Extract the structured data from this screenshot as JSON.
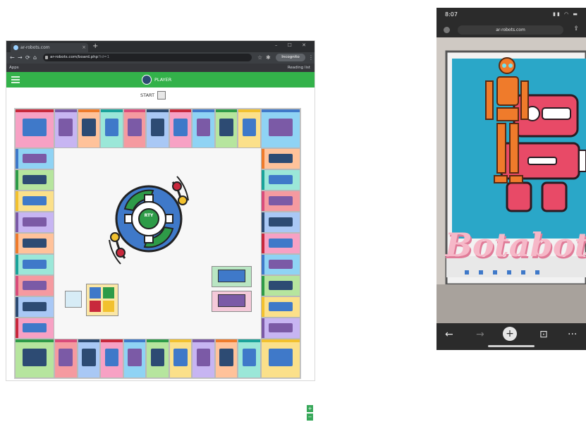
{
  "browser": {
    "tab_title": "ar-robots.com",
    "new_tab_symbol": "+",
    "window_controls": "– ☐ ✕",
    "tab_close_symbol": "×",
    "nav": {
      "back": "←",
      "forward": "→",
      "reload": "⟳",
      "home": "⌂"
    },
    "address": "ar-robots.com/board.php",
    "address_suffix": "?id=1",
    "profile_label": "Incognito",
    "bookmarks": {
      "apps_label": "Apps",
      "reading_list_label": "Reading list"
    }
  },
  "game": {
    "menu_icon": "hamburger-icon",
    "player_name": "PLAYER",
    "start_label": "START",
    "center_label": "RTY",
    "zoom_in": "+",
    "zoom_out": "−",
    "colors": {
      "header": "#33b24a",
      "accent_blue": "#3f79c9",
      "accent_green": "#2e9b48",
      "accent_yellow": "#f2c12e",
      "accent_red": "#c8283c"
    }
  },
  "phone": {
    "time": "8:07",
    "system_icons": "▮▮ ◠ ▬",
    "url": "ar-robots.com",
    "share_icon": "⇪",
    "ar_text": "Botabot",
    "bottom_bar": {
      "back": "←",
      "forward": "→",
      "new_tab": "+",
      "tabs": "⊡",
      "more": "···"
    }
  }
}
